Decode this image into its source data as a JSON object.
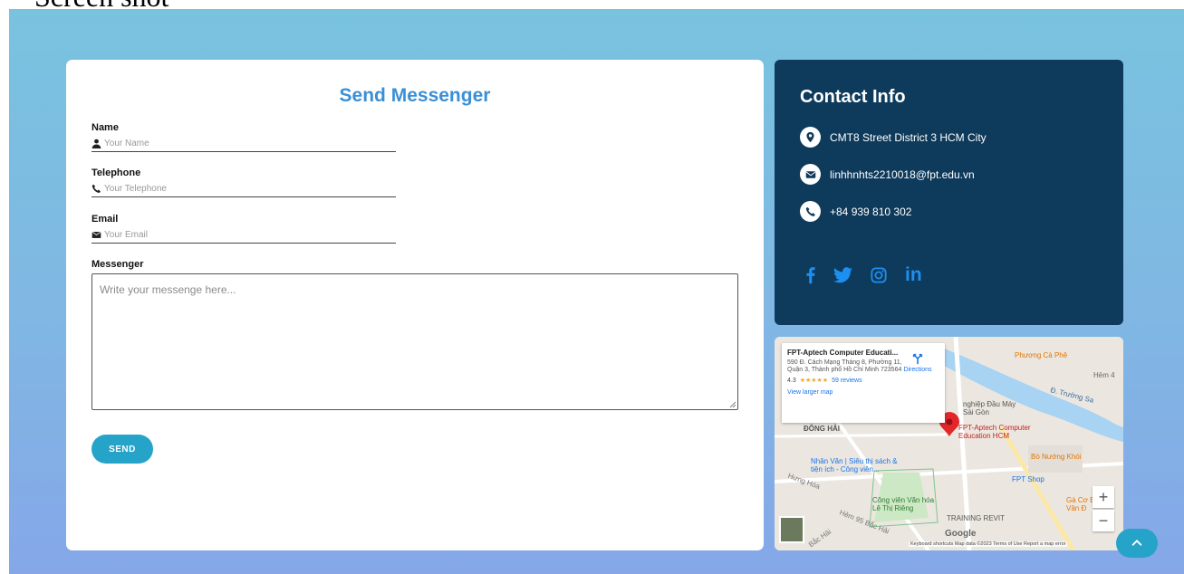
{
  "page": {
    "caption": "Screen shot"
  },
  "form": {
    "title": "Send Messenger",
    "name_label": "Name",
    "name_placeholder": "Your Name",
    "telephone_label": "Telephone",
    "telephone_placeholder": "Your Telephone",
    "email_label": "Email",
    "email_placeholder": "Your Email",
    "message_label": "Messenger",
    "message_placeholder": "Write your messenge here...",
    "send_label": "SEND"
  },
  "contact": {
    "title": "Contact Info",
    "address": "CMT8 Street District 3 HCM City",
    "email": "linhhnhts2210018@fpt.edu.vn",
    "phone": "+84 939 810 302",
    "socials": [
      "facebook-icon",
      "twitter-icon",
      "instagram-icon",
      "linkedin-icon"
    ],
    "linkedin_text": "in",
    "accent": "#1d8ff0",
    "background": "#0e3a5b"
  },
  "map": {
    "place_name": "FPT-Aptech Computer Educati...",
    "address": "590 Đ. Cách Mạng Tháng 8, Phường 11, Quận 3, Thành phố Hồ Chí Minh 723564",
    "rating": "4.3",
    "stars": "★★★★★",
    "reviews": "59 reviews",
    "directions": "Directions",
    "view_larger": "View larger map",
    "pin_label": "FPT-Aptech Computer Education HCM",
    "labels": {
      "cafe": "Phương Cà Phê",
      "hem": "Hẻm 4",
      "truong_sa": "Đ. Trường Sa",
      "nghiep_dau": "nghiệp Đầu Máy Sài Gòn",
      "dong_hai": "ĐÔNG HẢI",
      "nhan_van": "Nhân Văn | Siêu thị sách & tiện ích - Công viên...",
      "bo_nuong": "Bò Nướng Khói",
      "fpt_shop": "FPT Shop",
      "hung_hoa": "Hưng Hóa",
      "cong_vien": "Công viên Văn hóa Lê Thị Riêng",
      "ga_co": "Gà Cơ Bả Vân Đ",
      "training": "TRAINING REVIT",
      "hem95": "Hẻm 95 Bắc Hải",
      "bac_hai": "Bắc Hải",
      "google": "Google",
      "footer": "Keyboard shortcuts   Map data ©2023   Terms of Use   Report a map error",
      "zoom_in": "+",
      "zoom_out": "−"
    }
  },
  "colors": {
    "primary": "#26a3c9",
    "title_blue": "#3a8fd6"
  }
}
